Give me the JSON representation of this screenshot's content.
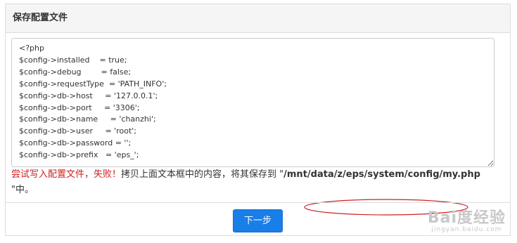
{
  "panel": {
    "title": "保存配置文件"
  },
  "config": {
    "content": "<?php\n$config->installed    = true;\n$config->debug        = false;\n$config->requestType  = 'PATH_INFO';\n$config->db->host     = '127.0.0.1';\n$config->db->port     = '3306';\n$config->db->name     = 'chanzhi';\n$config->db->user     = 'root';\n$config->db->password = '';\n$config->db->prefix   = 'eps_';"
  },
  "message": {
    "error": "尝试写入配置文件，失败！",
    "instruction": "拷贝上面文本框中的内容，将其保存到 \"",
    "path": "/mnt/data/z/eps/system/config/my.php",
    "suffix": " \"中。"
  },
  "footer": {
    "next_label": "下一步"
  },
  "watermark": {
    "logo": "Bai度经验",
    "url": "jingyan.baidu.com"
  },
  "colors": {
    "error": "#cc2222",
    "button": "#1a7ee8",
    "annotation": "#cc2222"
  }
}
